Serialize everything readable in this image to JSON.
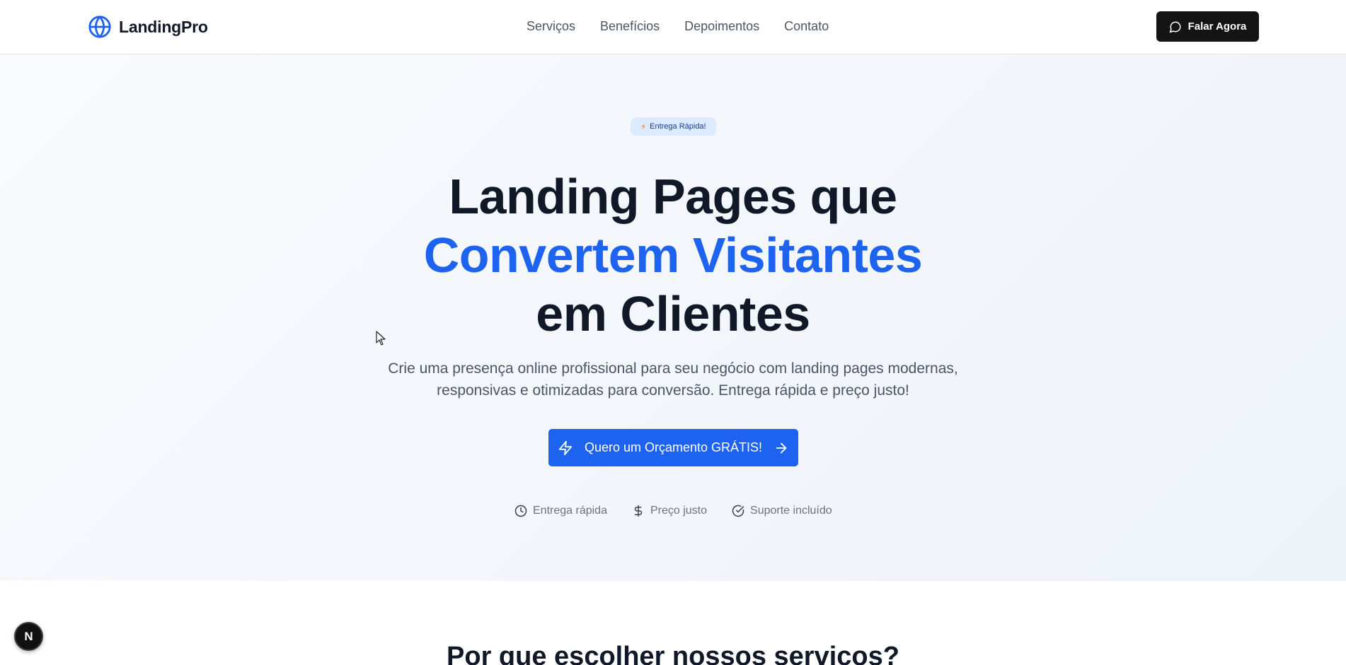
{
  "header": {
    "logo_text": "LandingPro",
    "nav": [
      "Serviços",
      "Benefícios",
      "Depoimentos",
      "Contato"
    ],
    "cta_label": "Falar Agora"
  },
  "hero": {
    "badge": "Entrega Rápida!",
    "title_line1": "Landing Pages que",
    "title_line2": "Convertem Visitantes",
    "title_line3": "em Clientes",
    "subtitle": "Crie uma presença online profissional para seu negócio com landing pages modernas, responsivas e otimizadas para conversão. Entrega rápida e preço justo!",
    "cta_label": "Quero um Orçamento GRÁTIS!",
    "features": [
      "Entrega rápida",
      "Preço justo",
      "Suporte incluído"
    ]
  },
  "section2": {
    "title": "Por que escolher nossos serviços?"
  },
  "dev_indicator": "N",
  "colors": {
    "accent": "#1d63f0",
    "header_button": "#141414",
    "badge_bg": "#dbeafe"
  }
}
